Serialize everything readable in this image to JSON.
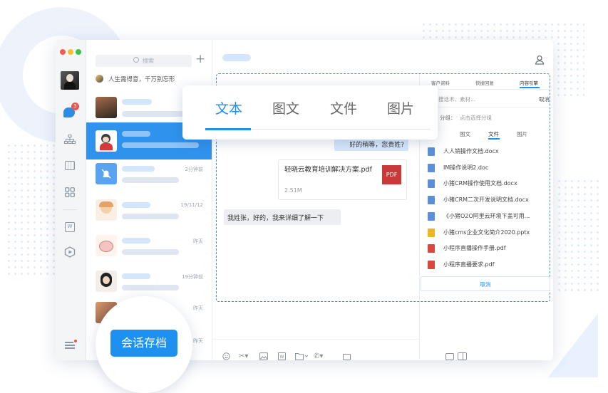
{
  "sidebar": {
    "badge": "3"
  },
  "conversation_list": {
    "search_placeholder": "搜索",
    "add_label": "+",
    "pinned_text": "人生需得意，千万别忘形",
    "items": [
      {
        "time": ""
      },
      {
        "time": ""
      },
      {
        "time": "2分钟前"
      },
      {
        "time": "19/11/12"
      },
      {
        "time": "昨天"
      },
      {
        "time": "19分钟前"
      },
      {
        "time": "昨天"
      },
      {
        "time": "昨天"
      }
    ]
  },
  "archive_badge": "会话存档",
  "content_tabs": {
    "items": [
      "文本",
      "图文",
      "文件",
      "图片"
    ],
    "active_index": 0
  },
  "messages": {
    "outgoing_1": "好的稍等，您贵姓?",
    "file_name": "轻晓云教育培训解决方案.pdf",
    "file_size": "2.51M",
    "file_type": "PDF",
    "incoming_1": "我姓张，好的，我来详细了解一下"
  },
  "right_panel": {
    "tabs": [
      "客户资料",
      "快捷回复",
      "内容引擎"
    ],
    "search_placeholder": "搜话术、素材...",
    "cancel_label": "取消",
    "group_label": "分组：",
    "group_hint": "点击选择分组",
    "sub_tabs": [
      "图文",
      "文件",
      "图片"
    ],
    "files": [
      {
        "name": "人人销操作文档.docx",
        "type": "doc"
      },
      {
        "name": "IM操作说明2.doc",
        "type": "doc"
      },
      {
        "name": "小猪CRM操作使用文档.docx",
        "type": "doc"
      },
      {
        "name": "小猪CRM二次开发说明文档.docx",
        "type": "doc"
      },
      {
        "name": "《小猪O2O阿里云环境下盖可用...",
        "type": "doc"
      },
      {
        "name": "小猪cms企业文化简介2020.pptx",
        "type": "ppt"
      },
      {
        "name": "小程序直播操作手册.pdf",
        "type": "pdf"
      },
      {
        "name": "小程序直播要求.pdf",
        "type": "pdf"
      }
    ],
    "send_label": "取消"
  },
  "colors": {
    "accent": "#1e90f0",
    "selected_row": "#2f93ee",
    "dashed_border": "#3a8fe0",
    "pdf_red": "#c9393a",
    "background_deco": "#eef3fb"
  }
}
